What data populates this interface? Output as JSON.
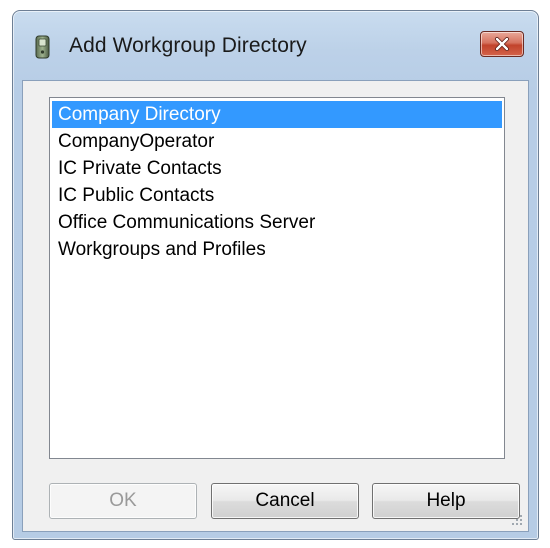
{
  "window": {
    "title": "Add Workgroup Directory",
    "app_icon": "handset-icon",
    "close_icon": "close-icon"
  },
  "directory_list": {
    "items": [
      {
        "label": "Company Directory",
        "selected": true
      },
      {
        "label": "CompanyOperator",
        "selected": false
      },
      {
        "label": "IC Private Contacts",
        "selected": false
      },
      {
        "label": "IC Public Contacts",
        "selected": false
      },
      {
        "label": "Office Communications Server",
        "selected": false
      },
      {
        "label": "Workgroups and Profiles",
        "selected": false
      }
    ]
  },
  "buttons": {
    "ok_label": "OK",
    "ok_enabled": false,
    "cancel_label": "Cancel",
    "help_label": "Help"
  },
  "colors": {
    "selection": "#3399ff",
    "title_bar": "#bcd1e8",
    "close_button": "#c1432c"
  }
}
